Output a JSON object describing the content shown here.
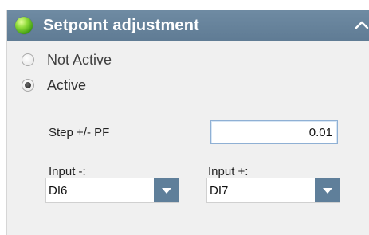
{
  "panel": {
    "title": "Setpoint adjustment",
    "status_color": "#6cc62a",
    "header_color": "#6a86a0"
  },
  "mode": {
    "options": [
      {
        "label": "Not Active",
        "selected": false
      },
      {
        "label": "Active",
        "selected": true
      }
    ]
  },
  "step": {
    "label": "Step +/- PF",
    "value": "0.01"
  },
  "input_minus": {
    "label": "Input -:",
    "value": "DI6"
  },
  "input_plus": {
    "label": "Input +:",
    "value": "DI7"
  }
}
